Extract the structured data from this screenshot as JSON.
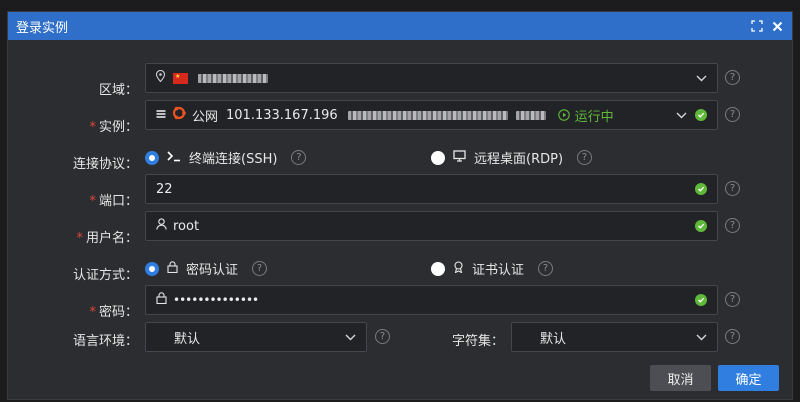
{
  "dialog": {
    "title": "登录实例"
  },
  "region": {
    "label": "区域：",
    "value_redacted": true
  },
  "instance": {
    "label": "实例：",
    "network": "公网",
    "ip": "101.133.167.196",
    "status": "运行中"
  },
  "protocol": {
    "label": "连接协议：",
    "options": [
      {
        "label": "终端连接(SSH)",
        "selected": true
      },
      {
        "label": "远程桌面(RDP)",
        "selected": false
      }
    ]
  },
  "port": {
    "label": "端口：",
    "value": "22"
  },
  "username": {
    "label": "用户名：",
    "value": "root"
  },
  "auth": {
    "label": "认证方式：",
    "options": [
      {
        "label": "密码认证",
        "selected": true
      },
      {
        "label": "证书认证",
        "selected": false
      }
    ]
  },
  "password": {
    "label": "密码：",
    "masked": "••••••••••••••"
  },
  "language": {
    "label": "语言环境：",
    "value": "默认"
  },
  "charset": {
    "label": "字符集：",
    "value": "默认"
  },
  "buttons": {
    "cancel": "取消",
    "confirm": "确定"
  },
  "colors": {
    "accent": "#2f7ee0",
    "titlebar": "#2f6fc9",
    "success": "#5fb83a",
    "required": "#e0463c"
  }
}
